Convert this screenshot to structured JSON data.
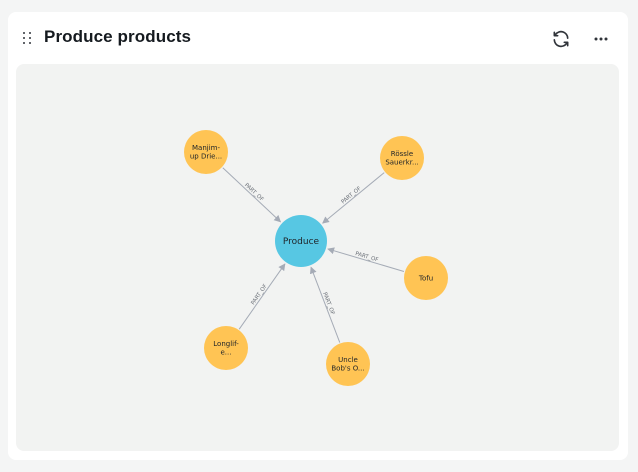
{
  "card": {
    "title": "Produce products",
    "refresh_icon": "refresh-icon",
    "more_icon": "more-horizontal-icon",
    "drag_icon": "drag-handle-icon"
  },
  "colors": {
    "center_node": "#57c7e3",
    "leaf_node": "#ffc454",
    "edge": "#a5abb6",
    "canvas_bg": "#f2f3f2"
  },
  "graph": {
    "center": {
      "label": "Produce"
    },
    "edge_label": "PART_OF",
    "nodes": [
      {
        "id": "n1",
        "label_lines": [
          "Manjim-",
          "up Drie..."
        ]
      },
      {
        "id": "n2",
        "label_lines": [
          "Rössle",
          "Sauerkr..."
        ]
      },
      {
        "id": "n3",
        "label_lines": [
          "Tofu"
        ]
      },
      {
        "id": "n4",
        "label_lines": [
          "Uncle",
          "Bob's O..."
        ]
      },
      {
        "id": "n5",
        "label_lines": [
          "Longlif-",
          "e..."
        ]
      }
    ]
  }
}
